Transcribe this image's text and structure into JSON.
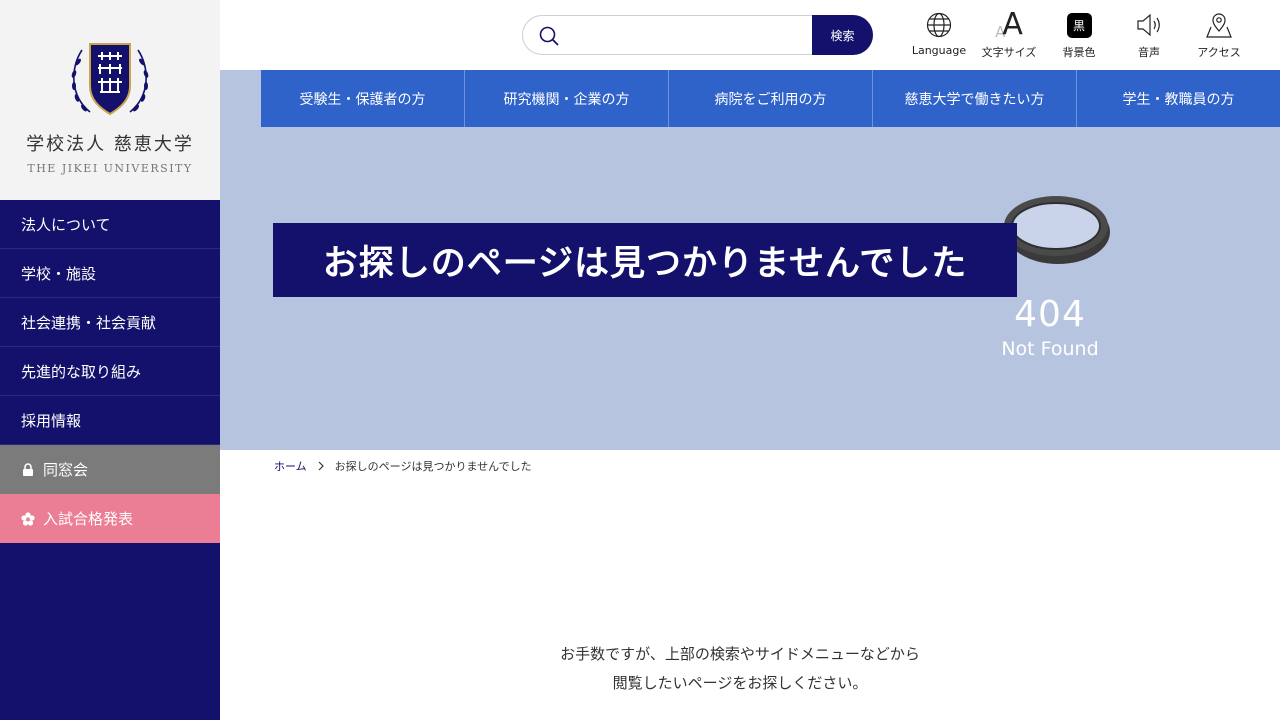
{
  "sidebar": {
    "logo": {
      "name_jp": "学校法人 慈恵大学",
      "name_en": "THE JIKEI UNIVERSITY"
    },
    "items": [
      {
        "label": "法人について"
      },
      {
        "label": "学校・施設"
      },
      {
        "label": "社会連携・社会貢献"
      },
      {
        "label": "先進的な取り組み"
      },
      {
        "label": "採用情報"
      },
      {
        "label": "同窓会",
        "icon": "lock-icon"
      },
      {
        "label": "入試合格発表",
        "icon": "flower-icon"
      }
    ],
    "colors": {
      "navy": "#13116b",
      "gray": "#7b7b7b",
      "pink": "#eb7d94"
    }
  },
  "header": {
    "search": {
      "placeholder": "",
      "button_label": "検索"
    },
    "tools": [
      {
        "label": "Language",
        "icon": "globe-icon"
      },
      {
        "label": "文字サイズ",
        "icon": "font-size-icon",
        "glyph_small": "A",
        "glyph_large": "A"
      },
      {
        "label": "背景色",
        "icon": "background-color-icon",
        "glyph": "黒"
      },
      {
        "label": "音声",
        "icon": "speaker-icon"
      },
      {
        "label": "アクセス",
        "icon": "map-pin-icon"
      }
    ]
  },
  "audience_nav": [
    {
      "label": "受験生・保護者の方"
    },
    {
      "label": "研究機関・企業の方"
    },
    {
      "label": "病院をご利用の方"
    },
    {
      "label": "慈恵大学で働きたい方"
    },
    {
      "label": "学生・教職員の方"
    }
  ],
  "hero": {
    "title": "お探しのページは見つかりませんでした",
    "error_code": "404",
    "error_text": "Not Found",
    "colors": {
      "background": "#b6c4e0",
      "title_bg": "#13116b",
      "nav_bg": "#2f63c9"
    }
  },
  "breadcrumb": {
    "home": "ホーム",
    "current": "お探しのページは見つかりませんでした"
  },
  "message": {
    "line1": "お手数ですが、上部の検索やサイドメニューなどから",
    "line2": "閲覧したいページをお探しください。"
  }
}
